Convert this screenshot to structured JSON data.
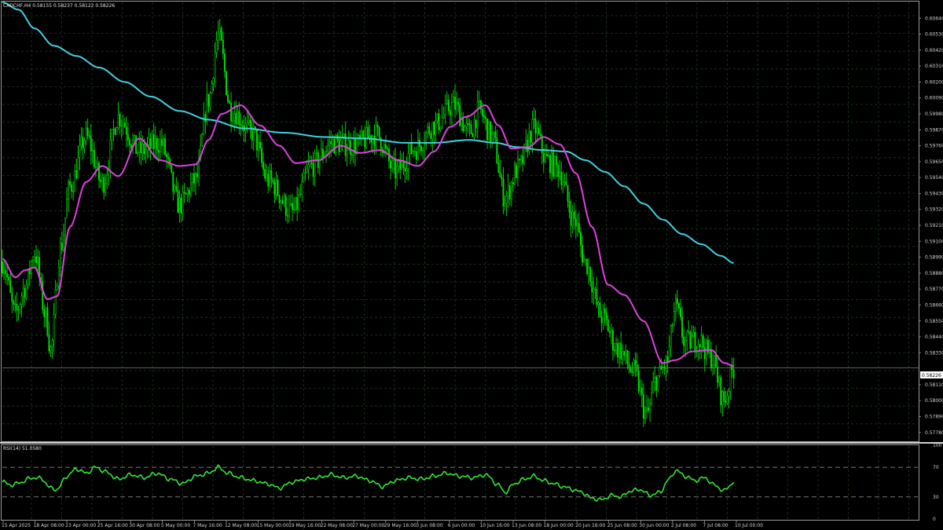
{
  "header": {
    "main_title": "CADCHF,H4  0.58155 0.58237 0.58122 0.58226",
    "rsi_title": "RSI(14) 51.0580"
  },
  "current_price_label": "0.58226",
  "colors": {
    "background": "#000000",
    "grid": "#1f3a1f",
    "candle": "#00dd00",
    "ma_fast": "#e040e0",
    "ma_slow": "#40d0e0",
    "rsi": "#32e632",
    "axis_text": "#d0d0d0",
    "price_line": "#808080"
  },
  "chart_data": [
    {
      "type": "candlestick",
      "symbol": "CADCHF",
      "timeframe": "H4",
      "ylim": [
        0.5773,
        0.6075
      ],
      "y_ticks": [
        "0.60640",
        "0.60530",
        "0.60420",
        "0.60310",
        "0.60200",
        "0.60090",
        "0.59980",
        "0.59870",
        "0.59760",
        "0.59650",
        "0.59540",
        "0.59430",
        "0.59320",
        "0.59210",
        "0.59100",
        "0.58990",
        "0.58880",
        "0.58770",
        "0.58660",
        "0.58550",
        "0.58440",
        "0.58330",
        "0.58110",
        "0.58000",
        "0.57890",
        "0.57780"
      ],
      "x_ticks": [
        "15 Apr 2025",
        "18 Apr 08:00",
        "23 Apr 00:00",
        "25 Apr 16:00",
        "30 Apr 08:00",
        "5 May 00:00",
        "7 May 16:00",
        "12 May 08:00",
        "15 May 00:00",
        "19 May 16:00",
        "22 May 08:00",
        "27 May 00:00",
        "29 May 16:00",
        "3 Jun 08:00",
        "6 Jun 00:00",
        "10 Jun 16:00",
        "13 Jun 08:00",
        "18 Jun 00:00",
        "20 Jun 16:00",
        "25 Jun 08:00",
        "30 Jun 00:00",
        "2 Jul 08:00",
        "7 Jul 08:00",
        "10 Jul 00:00"
      ],
      "close_anchors": [
        [
          0,
          0.5896
        ],
        [
          8,
          0.586
        ],
        [
          14,
          0.5878
        ],
        [
          20,
          0.5902
        ],
        [
          27,
          0.5858
        ],
        [
          30,
          0.5835
        ],
        [
          36,
          0.5905
        ],
        [
          42,
          0.5948
        ],
        [
          52,
          0.5982
        ],
        [
          62,
          0.595
        ],
        [
          72,
          0.5996
        ],
        [
          85,
          0.5972
        ],
        [
          98,
          0.5978
        ],
        [
          110,
          0.5935
        ],
        [
          120,
          0.5952
        ],
        [
          128,
          0.6008
        ],
        [
          134,
          0.6052
        ],
        [
          142,
          0.6001
        ],
        [
          155,
          0.5985
        ],
        [
          165,
          0.5952
        ],
        [
          180,
          0.593
        ],
        [
          192,
          0.5962
        ],
        [
          205,
          0.5978
        ],
        [
          218,
          0.5976
        ],
        [
          232,
          0.5984
        ],
        [
          244,
          0.5958
        ],
        [
          256,
          0.5974
        ],
        [
          268,
          0.599
        ],
        [
          280,
          0.6004
        ],
        [
          290,
          0.5985
        ],
        [
          296,
          0.6
        ],
        [
          304,
          0.5982
        ],
        [
          312,
          0.594
        ],
        [
          320,
          0.596
        ],
        [
          330,
          0.5988
        ],
        [
          338,
          0.5966
        ],
        [
          345,
          0.596
        ],
        [
          355,
          0.5925
        ],
        [
          362,
          0.5895
        ],
        [
          372,
          0.5858
        ],
        [
          382,
          0.5836
        ],
        [
          392,
          0.582
        ],
        [
          400,
          0.579
        ],
        [
          406,
          0.5815
        ],
        [
          412,
          0.5825
        ],
        [
          418,
          0.5864
        ],
        [
          424,
          0.584
        ],
        [
          432,
          0.5842
        ],
        [
          440,
          0.583
        ],
        [
          448,
          0.58
        ],
        [
          454,
          0.5822
        ]
      ],
      "ma_fast_anchors": [
        [
          0,
          0.5898
        ],
        [
          8,
          0.5885
        ],
        [
          14,
          0.589
        ],
        [
          20,
          0.5892
        ],
        [
          28,
          0.587
        ],
        [
          34,
          0.5872
        ],
        [
          42,
          0.592
        ],
        [
          52,
          0.5951
        ],
        [
          62,
          0.5962
        ],
        [
          72,
          0.5955
        ],
        [
          85,
          0.5981
        ],
        [
          98,
          0.5966
        ],
        [
          110,
          0.5962
        ],
        [
          120,
          0.5963
        ],
        [
          128,
          0.598
        ],
        [
          136,
          0.5998
        ],
        [
          148,
          0.6004
        ],
        [
          160,
          0.599
        ],
        [
          172,
          0.5976
        ],
        [
          182,
          0.5964
        ],
        [
          196,
          0.5966
        ],
        [
          210,
          0.5976
        ],
        [
          222,
          0.5971
        ],
        [
          234,
          0.5973
        ],
        [
          246,
          0.5966
        ],
        [
          258,
          0.5962
        ],
        [
          268,
          0.5972
        ],
        [
          278,
          0.5989
        ],
        [
          288,
          0.5996
        ],
        [
          300,
          0.6004
        ],
        [
          308,
          0.599
        ],
        [
          316,
          0.5974
        ],
        [
          326,
          0.5975
        ],
        [
          336,
          0.5982
        ],
        [
          346,
          0.5977
        ],
        [
          356,
          0.5957
        ],
        [
          366,
          0.592
        ],
        [
          376,
          0.588
        ],
        [
          386,
          0.5873
        ],
        [
          398,
          0.5855
        ],
        [
          410,
          0.5826
        ],
        [
          418,
          0.5828
        ],
        [
          428,
          0.5834
        ],
        [
          440,
          0.5835
        ],
        [
          448,
          0.5826
        ],
        [
          454,
          0.5824
        ]
      ],
      "ma_slow_anchors": [
        [
          0,
          0.6075
        ],
        [
          10,
          0.607
        ],
        [
          20,
          0.6057
        ],
        [
          32,
          0.6045
        ],
        [
          46,
          0.6038
        ],
        [
          60,
          0.603
        ],
        [
          76,
          0.602
        ],
        [
          92,
          0.601
        ],
        [
          110,
          0.6
        ],
        [
          128,
          0.5994
        ],
        [
          150,
          0.5988
        ],
        [
          175,
          0.5985
        ],
        [
          200,
          0.5982
        ],
        [
          225,
          0.5981
        ],
        [
          250,
          0.5978
        ],
        [
          268,
          0.5978
        ],
        [
          290,
          0.598
        ],
        [
          306,
          0.5978
        ],
        [
          320,
          0.5975
        ],
        [
          335,
          0.5973
        ],
        [
          350,
          0.5972
        ],
        [
          362,
          0.5966
        ],
        [
          374,
          0.5958
        ],
        [
          386,
          0.5948
        ],
        [
          398,
          0.5936
        ],
        [
          410,
          0.5925
        ],
        [
          422,
          0.5915
        ],
        [
          434,
          0.5908
        ],
        [
          446,
          0.59
        ],
        [
          454,
          0.5895
        ]
      ]
    },
    {
      "type": "line",
      "name": "RSI(14)",
      "ylim": [
        0,
        100
      ],
      "levels": [
        30,
        70
      ],
      "y_ticks": [
        "100",
        "70",
        "30",
        "0"
      ],
      "anchors": [
        [
          0,
          50
        ],
        [
          6,
          46
        ],
        [
          12,
          50
        ],
        [
          18,
          56
        ],
        [
          24,
          55
        ],
        [
          30,
          42
        ],
        [
          34,
          40
        ],
        [
          40,
          58
        ],
        [
          46,
          68
        ],
        [
          52,
          62
        ],
        [
          58,
          70
        ],
        [
          64,
          64
        ],
        [
          72,
          54
        ],
        [
          80,
          60
        ],
        [
          88,
          56
        ],
        [
          96,
          62
        ],
        [
          104,
          54
        ],
        [
          112,
          48
        ],
        [
          120,
          58
        ],
        [
          128,
          62
        ],
        [
          134,
          70
        ],
        [
          140,
          62
        ],
        [
          148,
          56
        ],
        [
          156,
          52
        ],
        [
          164,
          48
        ],
        [
          172,
          42
        ],
        [
          180,
          50
        ],
        [
          188,
          54
        ],
        [
          196,
          56
        ],
        [
          204,
          60
        ],
        [
          212,
          56
        ],
        [
          220,
          58
        ],
        [
          228,
          52
        ],
        [
          236,
          44
        ],
        [
          244,
          52
        ],
        [
          252,
          56
        ],
        [
          260,
          54
        ],
        [
          268,
          58
        ],
        [
          276,
          62
        ],
        [
          284,
          58
        ],
        [
          292,
          56
        ],
        [
          300,
          60
        ],
        [
          308,
          46
        ],
        [
          312,
          36
        ],
        [
          318,
          48
        ],
        [
          324,
          54
        ],
        [
          330,
          58
        ],
        [
          336,
          52
        ],
        [
          342,
          48
        ],
        [
          348,
          44
        ],
        [
          354,
          40
        ],
        [
          360,
          36
        ],
        [
          366,
          28
        ],
        [
          372,
          26
        ],
        [
          378,
          32
        ],
        [
          384,
          30
        ],
        [
          390,
          38
        ],
        [
          396,
          40
        ],
        [
          402,
          32
        ],
        [
          408,
          36
        ],
        [
          414,
          54
        ],
        [
          418,
          66
        ],
        [
          424,
          58
        ],
        [
          430,
          52
        ],
        [
          436,
          56
        ],
        [
          442,
          46
        ],
        [
          448,
          38
        ],
        [
          452,
          46
        ],
        [
          454,
          51
        ]
      ]
    }
  ]
}
